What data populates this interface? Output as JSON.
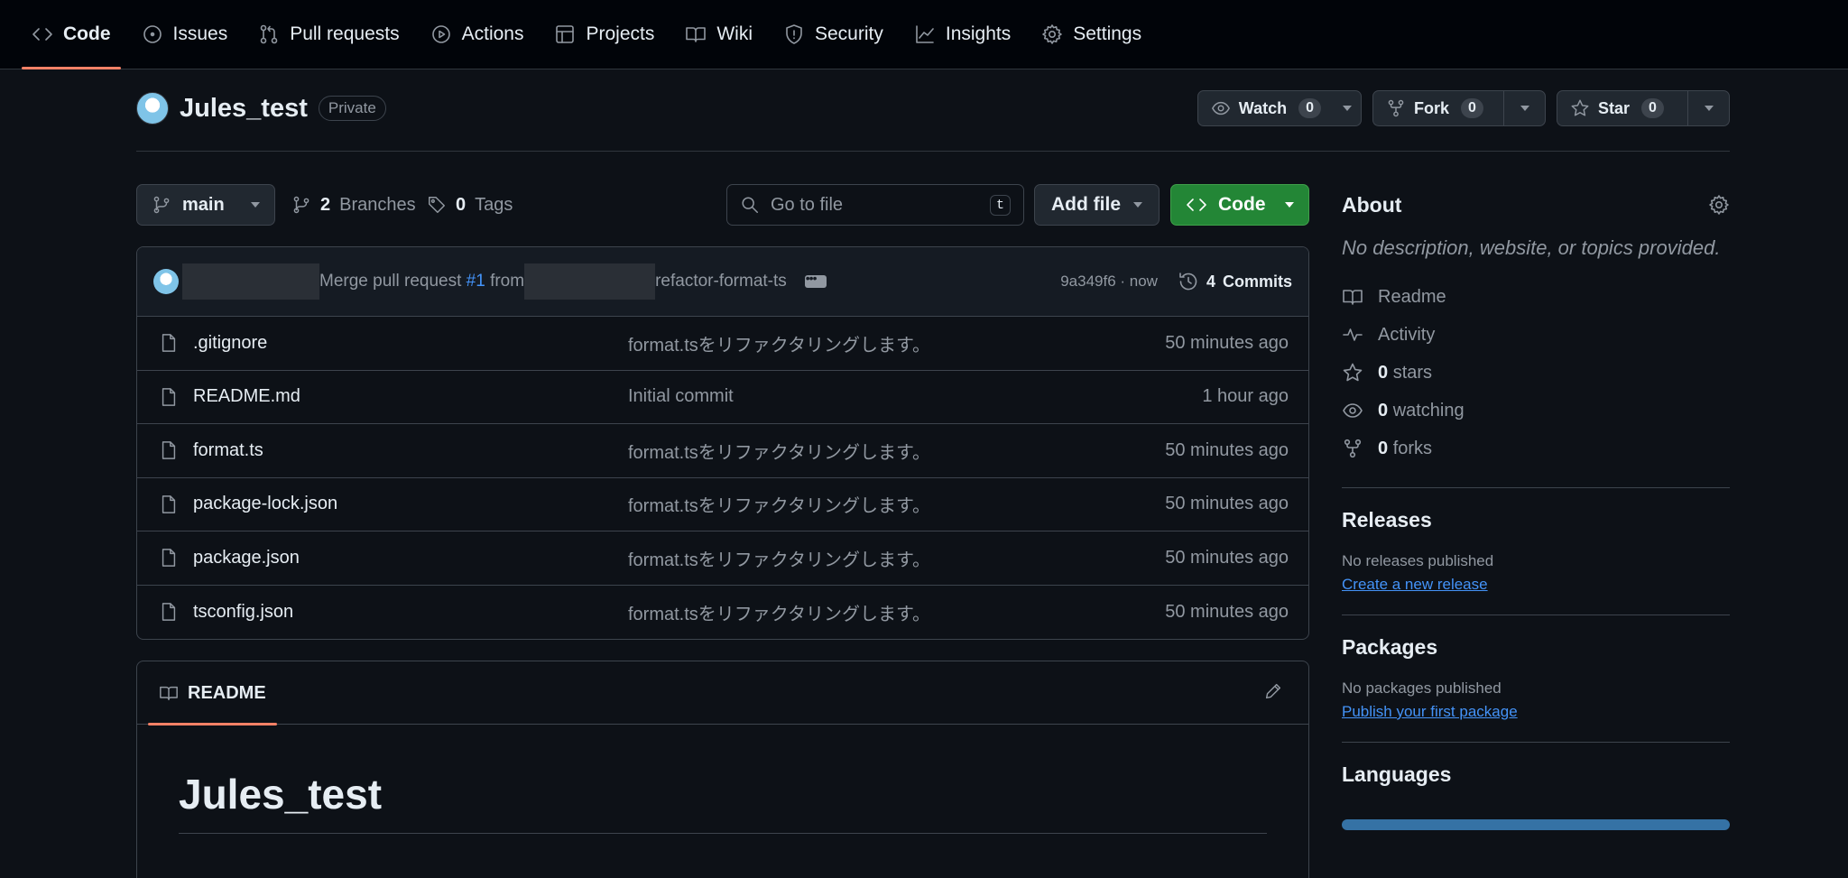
{
  "nav": {
    "tabs": [
      {
        "label": "Code",
        "icon": "code-icon"
      },
      {
        "label": "Issues",
        "icon": "issue-opened-icon"
      },
      {
        "label": "Pull requests",
        "icon": "git-pull-request-icon"
      },
      {
        "label": "Actions",
        "icon": "play-icon"
      },
      {
        "label": "Projects",
        "icon": "table-icon"
      },
      {
        "label": "Wiki",
        "icon": "book-icon"
      },
      {
        "label": "Security",
        "icon": "shield-icon"
      },
      {
        "label": "Insights",
        "icon": "graph-icon"
      },
      {
        "label": "Settings",
        "icon": "gear-icon"
      }
    ]
  },
  "repo": {
    "name": "Jules_test",
    "visibility": "Private",
    "watch": {
      "label": "Watch",
      "count": "0"
    },
    "fork": {
      "label": "Fork",
      "count": "0"
    },
    "star": {
      "label": "Star",
      "count": "0"
    }
  },
  "toolbar": {
    "branch": "main",
    "branches_count": "2",
    "branches_label": "Branches",
    "tags_count": "0",
    "tags_label": "Tags",
    "search_placeholder": "Go to file",
    "search_shortcut": "t",
    "add_file_label": "Add file",
    "code_label": "Code"
  },
  "latest_commit": {
    "message_prefix": "Merge pull request ",
    "pr_link": "#1",
    "message_from": " from",
    "branch_suffix": "refactor-format-ts",
    "sha_time": "9a349f6 · now",
    "commits_count": "4",
    "commits_label": "Commits"
  },
  "files": [
    {
      "name": ".gitignore",
      "commit": "format.tsをリファクタリングします。",
      "time": "50 minutes ago"
    },
    {
      "name": "README.md",
      "commit": "Initial commit",
      "time": "1 hour ago"
    },
    {
      "name": "format.ts",
      "commit": "format.tsをリファクタリングします。",
      "time": "50 minutes ago"
    },
    {
      "name": "package-lock.json",
      "commit": "format.tsをリファクタリングします。",
      "time": "50 minutes ago"
    },
    {
      "name": "package.json",
      "commit": "format.tsをリファクタリングします。",
      "time": "50 minutes ago"
    },
    {
      "name": "tsconfig.json",
      "commit": "format.tsをリファクタリングします。",
      "time": "50 minutes ago"
    }
  ],
  "readme": {
    "tab_label": "README",
    "title": "Jules_test"
  },
  "about": {
    "heading": "About",
    "description": "No description, website, or topics provided.",
    "readme_label": "Readme",
    "activity_label": "Activity",
    "stars_count": "0",
    "stars_label": "stars",
    "watching_count": "0",
    "watching_label": "watching",
    "forks_count": "0",
    "forks_label": "forks"
  },
  "releases": {
    "heading": "Releases",
    "note": "No releases published",
    "link": "Create a new release"
  },
  "packages": {
    "heading": "Packages",
    "note": "No packages published",
    "link": "Publish your first package"
  },
  "languages": {
    "heading": "Languages",
    "bar_color": "#3572a5"
  },
  "colors": {
    "accent_underline": "#f78166",
    "link": "#4493f8",
    "primary_button": "#238636"
  }
}
